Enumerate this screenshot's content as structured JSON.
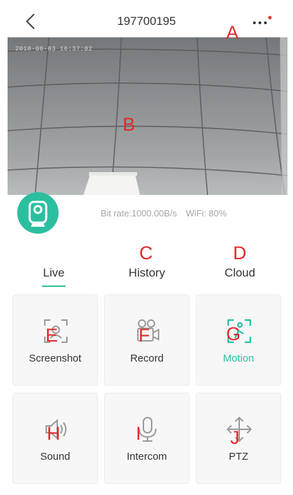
{
  "header": {
    "title": "197700195"
  },
  "video": {
    "timestamp": "2018-08-03 16:37:02"
  },
  "stats": {
    "bitrate": "Bit rate:1000.00B/s",
    "wifi": "WiFi: 80%"
  },
  "tabs": [
    {
      "label": "Live",
      "active": true
    },
    {
      "label": "History",
      "active": false
    },
    {
      "label": "Cloud",
      "active": false
    }
  ],
  "controls": [
    {
      "label": "Screenshot",
      "icon": "screenshot-icon",
      "active": false
    },
    {
      "label": "Record",
      "icon": "video-camera-icon",
      "active": false
    },
    {
      "label": "Motion",
      "icon": "motion-detection-icon",
      "active": true
    },
    {
      "label": "Sound",
      "icon": "speaker-icon",
      "active": false
    },
    {
      "label": "Intercom",
      "icon": "microphone-icon",
      "active": false
    },
    {
      "label": "PTZ",
      "icon": "pan-tilt-arrows-icon",
      "active": false
    }
  ],
  "annotations": {
    "a": "A",
    "b": "B",
    "c": "C",
    "d": "D",
    "e": "E",
    "f": "F",
    "g": "G",
    "h": "H",
    "i": "I",
    "j": "J"
  },
  "colors": {
    "accent": "#2bbfa0",
    "annotation": "#e2282a",
    "badge": "#e0342f"
  }
}
